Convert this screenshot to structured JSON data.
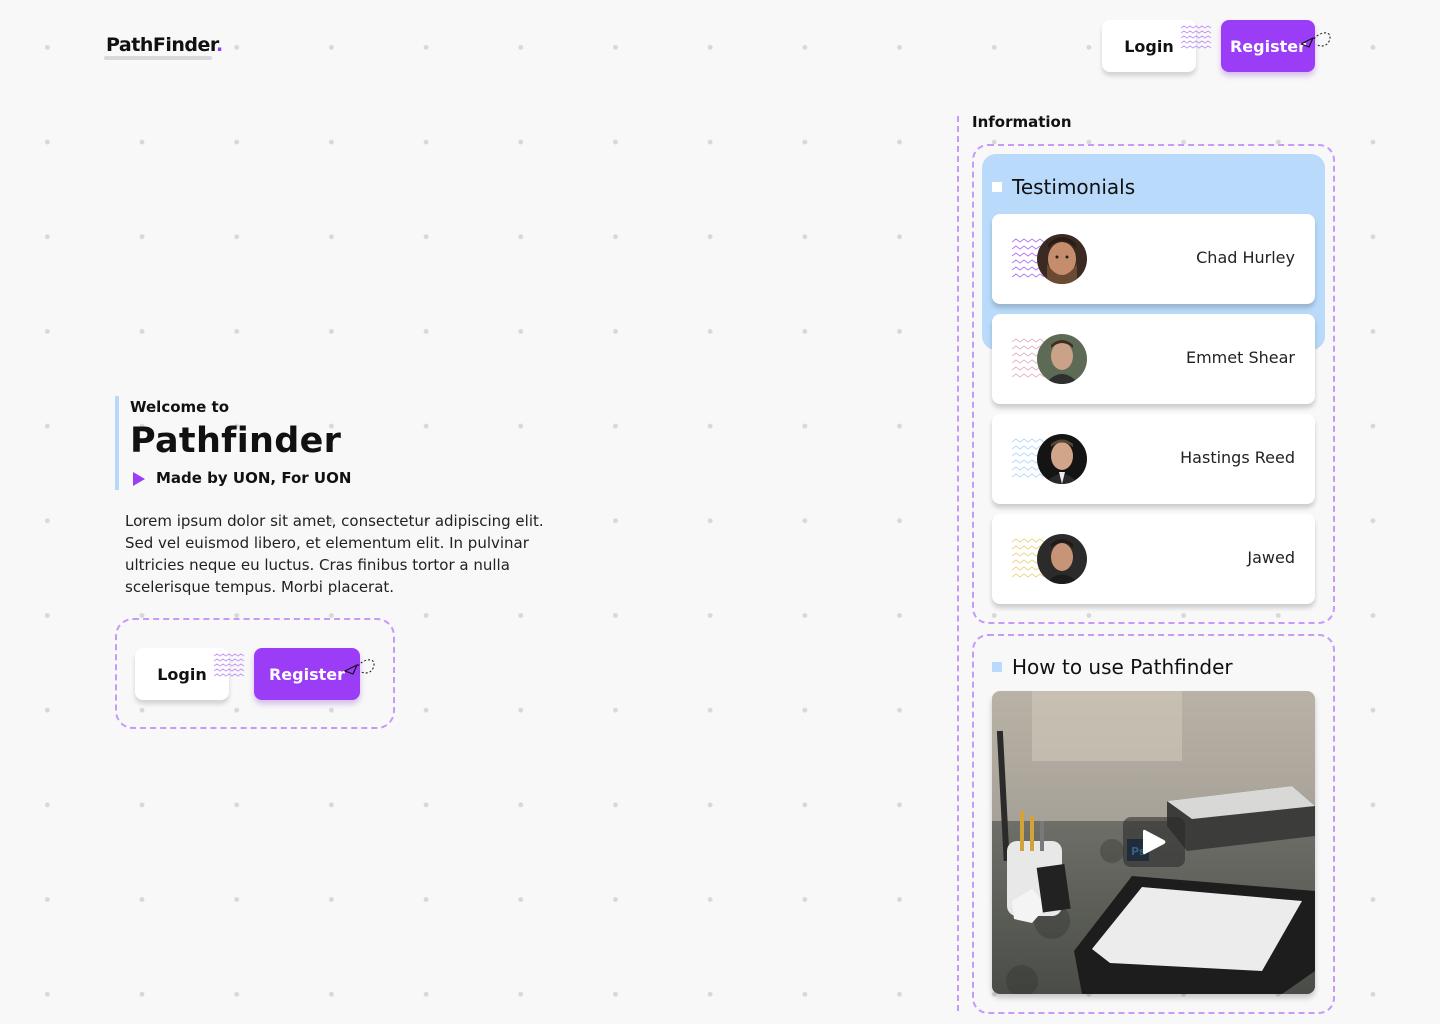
{
  "header": {
    "logo_text": "PathFinder",
    "logo_dot": ".",
    "login_label": "Login",
    "register_label": "Register"
  },
  "hero": {
    "welcome": "Welcome to",
    "title": "Pathfinder",
    "tagline": "Made by UON, For UON",
    "description": "Lorem ipsum dolor sit amet, consectetur adipiscing elit. Sed vel euismod libero, et elementum elit. In pulvinar ultricies neque eu luctus. Cras finibus tortor a nulla scelerisque tempus. Morbi placerat.",
    "login_label": "Login",
    "register_label": "Register"
  },
  "information": {
    "label": "Information",
    "testimonials_heading": "Testimonials",
    "testimonials": [
      {
        "name": "Chad Hurley"
      },
      {
        "name": "Emmet Shear"
      },
      {
        "name": "Hastings Reed"
      },
      {
        "name": "Jawed"
      }
    ],
    "how_to_heading": "How to use Pathfinder"
  },
  "colors": {
    "accent": "#9b3cf6",
    "light_blue": "#b9dafa",
    "background": "#f8f8f8"
  }
}
